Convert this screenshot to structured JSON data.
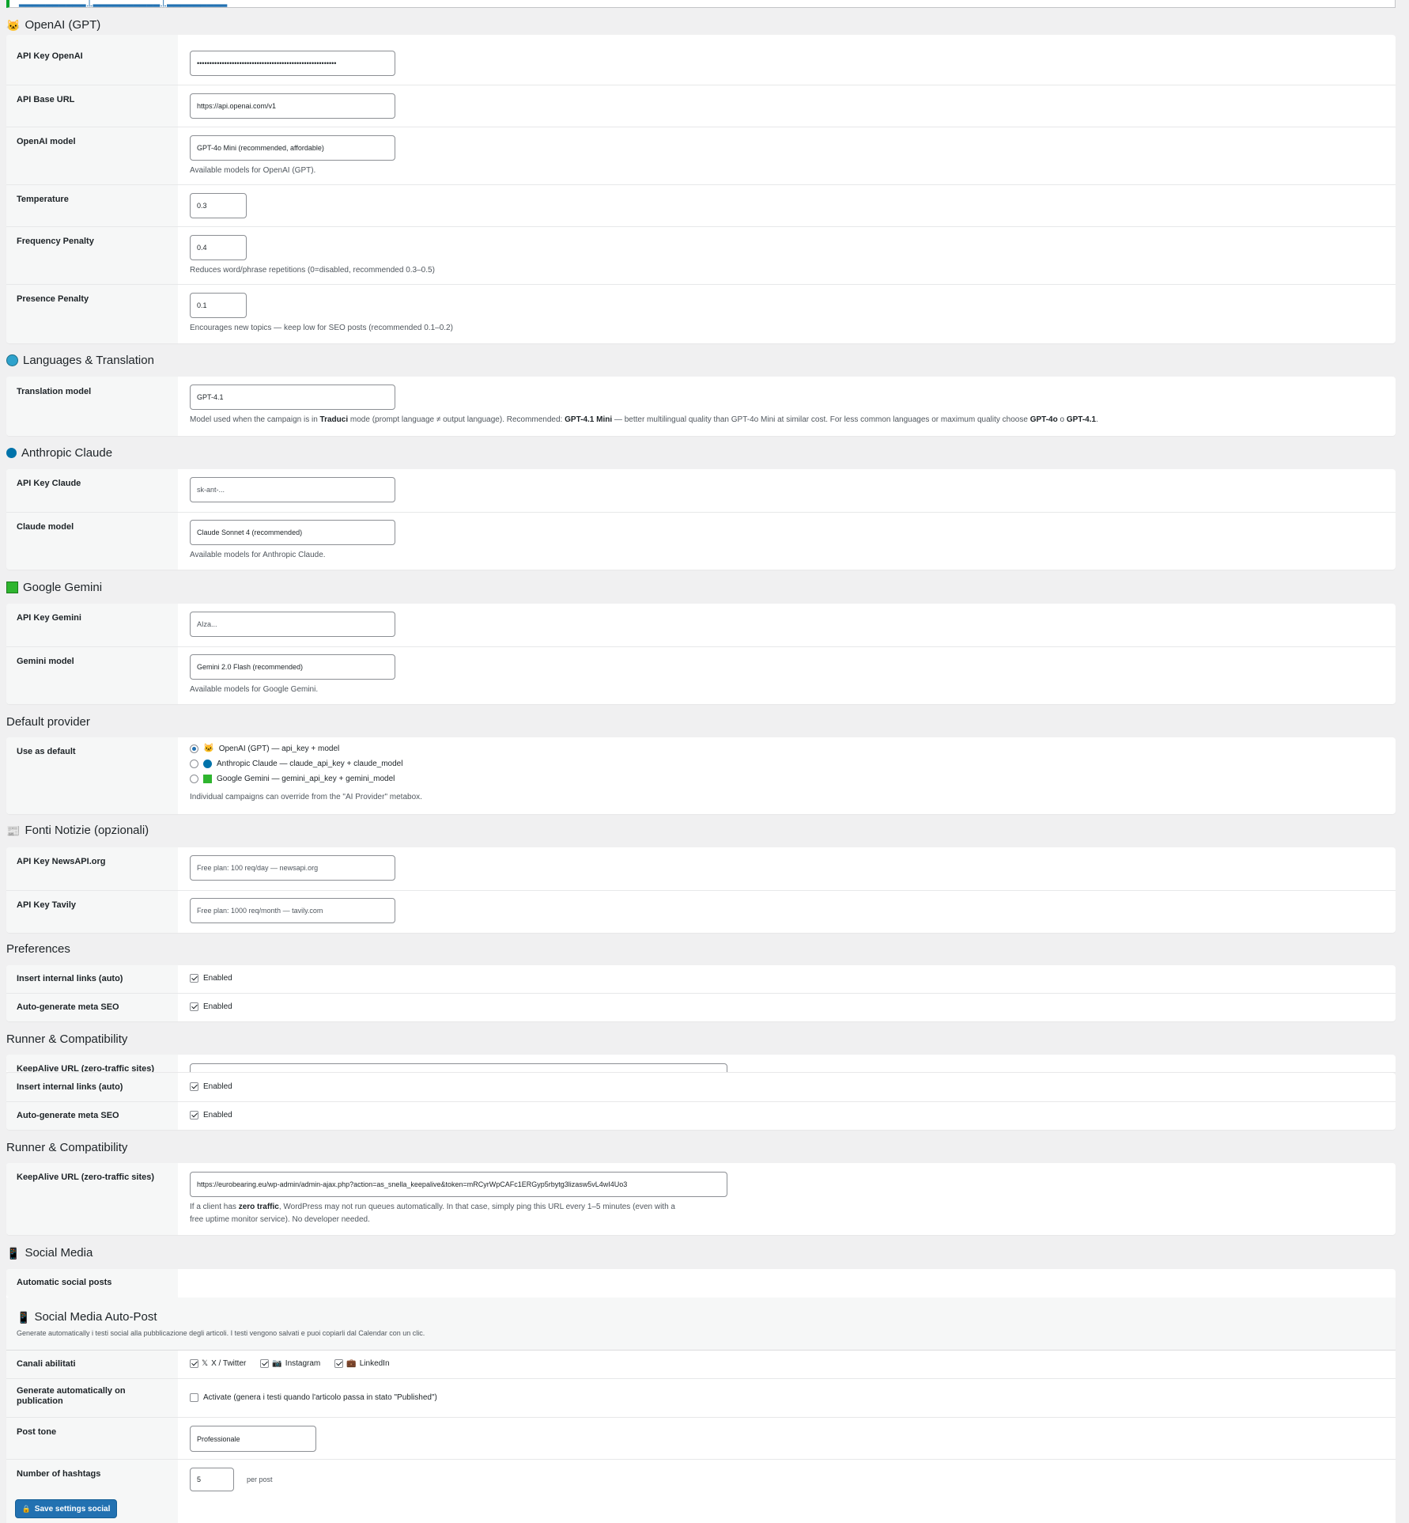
{
  "top_notice": {
    "links": "▂▂▂▂▂▂▂▂▂▂ | ▂▂▂▂▂▂▂▂▂▂ | ▂▂▂▂▂▂▂▂▂"
  },
  "openai": {
    "title": "OpenAI (GPT)",
    "api_key_label": "API Key OpenAI",
    "api_key_value": "••••••••••••••••••••••••••••••••••••••••••••••••••••••••",
    "base_url_label": "API Base URL",
    "base_url_value": "https://api.openai.com/v1",
    "model_label": "OpenAI model",
    "model_value": "GPT-4o Mini (recommended, affordable)",
    "model_desc": "Available models for OpenAI (GPT).",
    "temperature_label": "Temperature",
    "temperature_value": "0.3",
    "freq_label": "Frequency Penalty",
    "freq_value": "0.4",
    "freq_desc": "Reduces word/phrase repetitions (0=disabled, recommended 0.3–0.5)",
    "presence_label": "Presence Penalty",
    "presence_value": "0.1",
    "presence_desc": "Encourages new topics — keep low for SEO posts (recommended 0.1–0.2)"
  },
  "languages": {
    "title": "Languages & Translation",
    "model_label": "Translation model",
    "model_value": "GPT-4.1",
    "desc_1": "Model used when the campaign is in ",
    "desc_traduci": "Traduci",
    "desc_2": " mode (prompt language ≠ output language). Recommended: ",
    "desc_rec": "GPT-4.1 Mini",
    "desc_3": " — better multilingual quality than GPT-4o Mini at similar cost. For less common languages or maximum quality choose ",
    "desc_opt1": "GPT-4o",
    "desc_o": " o ",
    "desc_opt2": "GPT-4.1",
    "desc_end": "."
  },
  "claude": {
    "title": "Anthropic Claude",
    "api_key_label": "API Key Claude",
    "api_key_placeholder": "sk-ant-...",
    "model_label": "Claude model",
    "model_value": "Claude Sonnet 4 (recommended)",
    "model_desc": "Available models for Anthropic Claude."
  },
  "gemini": {
    "title": "Google Gemini",
    "api_key_label": "API Key Gemini",
    "api_key_placeholder": "AIza...",
    "model_label": "Gemini model",
    "model_value": "Gemini 2.0 Flash (recommended)",
    "model_desc": "Available models for Google Gemini."
  },
  "default_provider": {
    "title": "Default provider",
    "label": "Use as default",
    "options": [
      {
        "text": "OpenAI (GPT) — api_key + model",
        "selected": true
      },
      {
        "text": "Anthropic Claude — claude_api_key + claude_model",
        "selected": false
      },
      {
        "text": "Google Gemini — gemini_api_key + gemini_model",
        "selected": false
      }
    ],
    "desc": "Individual campaigns can override from the \"AI Provider\" metabox."
  },
  "news": {
    "title": "Fonti Notizie (opzionali)",
    "newsapi_label": "API Key NewsAPI.org",
    "newsapi_placeholder": "Free plan: 100 req/day — newsapi.org",
    "tavily_label": "API Key Tavily",
    "tavily_placeholder": "Free plan: 1000 req/month — tavily.com"
  },
  "preferences": {
    "title": "Preferences",
    "links_label": "Insert internal links (auto)",
    "links_value": "Enabled",
    "meta_label": "Auto-generate meta SEO",
    "meta_value": "Enabled"
  },
  "runner": {
    "title": "Runner & Compatibility",
    "keepalive_label": "KeepAlive URL (zero-traffic sites)",
    "keepalive_value": "https://eurobearing.eu/wp-admin/admin-ajax.php?action=as_snella_keepalive&token=mRCyrWpCAFc1ERGyp5rbytg3lizasw5vL4wI4Uo3",
    "desc_1": "If a client has ",
    "desc_bold": "zero traffic",
    "desc_2": ", WordPress may not run queues automatically. In that case, simply ping this URL every 1–5 minutes (even with a",
    "desc_3": "free uptime monitor service). No developer needed."
  },
  "social": {
    "title": "Social Media",
    "auto_label": "Automatic social posts",
    "inner_title": "Social Media Auto-Post",
    "inner_desc": "Generate automatically i testi social alla pubblicazione degli articoli. I testi vengono salvati e puoi copiarli dal Calendar con un clic.",
    "channels_label": "Canali abilitati",
    "channels": [
      {
        "icon": "𝕏",
        "text": "X / Twitter"
      },
      {
        "icon": "📷",
        "text": "Instagram"
      },
      {
        "icon": "💼",
        "text": "LinkedIn"
      }
    ],
    "autogen_label": "Generate automatically on publication",
    "autogen_value": "Activate (genera i testi quando l'articolo passa in stato \"Published\")",
    "tone_label": "Post tone",
    "tone_value": "Professionale",
    "hashtags_label": "Number of hashtags",
    "hashtags_value": "5",
    "hashtags_unit": "per post",
    "save_label": "Save settings social"
  },
  "icons": {
    "openai": "🐱",
    "languages_color": "#2ea2cc",
    "claude_color": "#0073aa",
    "gemini_color": "#2fb52f",
    "news": "📰",
    "social": "📱",
    "save": "🔒"
  }
}
